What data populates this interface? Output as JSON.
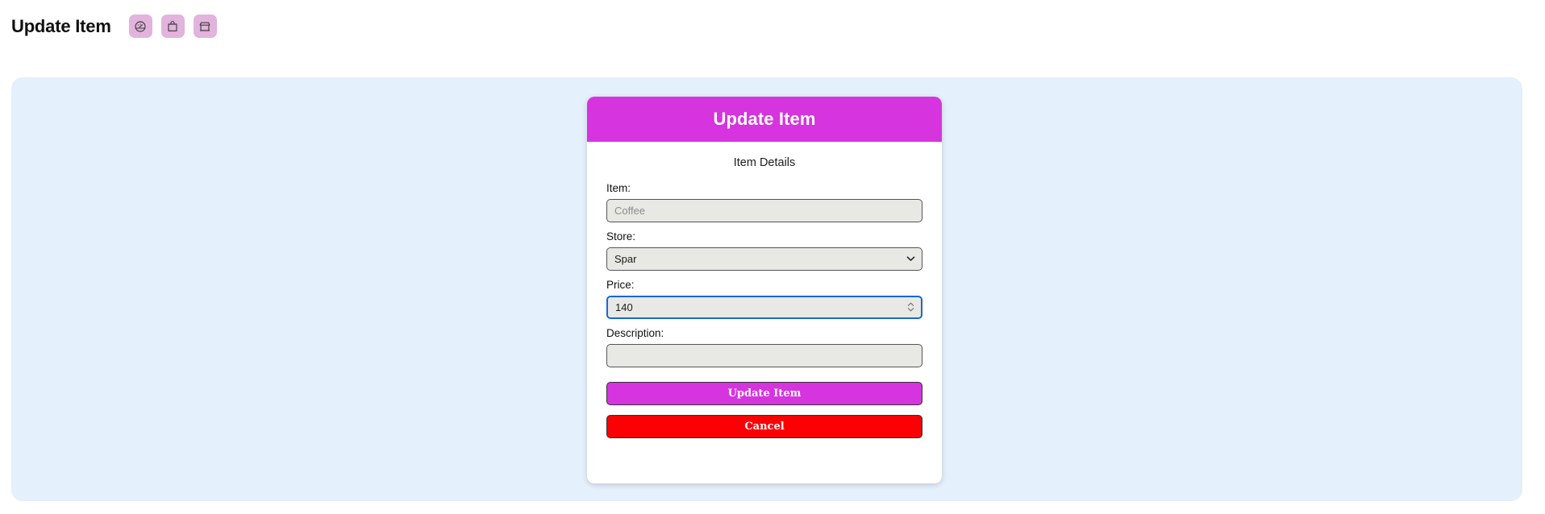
{
  "topbar": {
    "app_title": "Update Item",
    "nav_icons": [
      {
        "name": "dashboard-icon",
        "label": "Dashboard"
      },
      {
        "name": "shopping-bag-icon",
        "label": "Items"
      },
      {
        "name": "storefront-icon",
        "label": "Stores"
      }
    ]
  },
  "card": {
    "header_title": "Update Item",
    "section_subtitle": "Item Details",
    "fields": {
      "item": {
        "label": "Item:",
        "value": "",
        "placeholder": "Coffee"
      },
      "store": {
        "label": "Store:",
        "value": "Spar",
        "options": [
          "Spar"
        ]
      },
      "price": {
        "label": "Price:",
        "value": "140",
        "placeholder": ""
      },
      "description": {
        "label": "Description:",
        "value": "",
        "placeholder": ""
      }
    },
    "buttons": {
      "submit_label": "Update Item",
      "cancel_label": "Cancel"
    }
  },
  "colors": {
    "brand_magenta": "#d534df",
    "cancel_red": "#fb0005",
    "panel_blue": "#e4f0fb",
    "icon_chip": "#e2b3dc",
    "focus_blue": "#1668d4",
    "input_grey": "#e8e8e4"
  }
}
